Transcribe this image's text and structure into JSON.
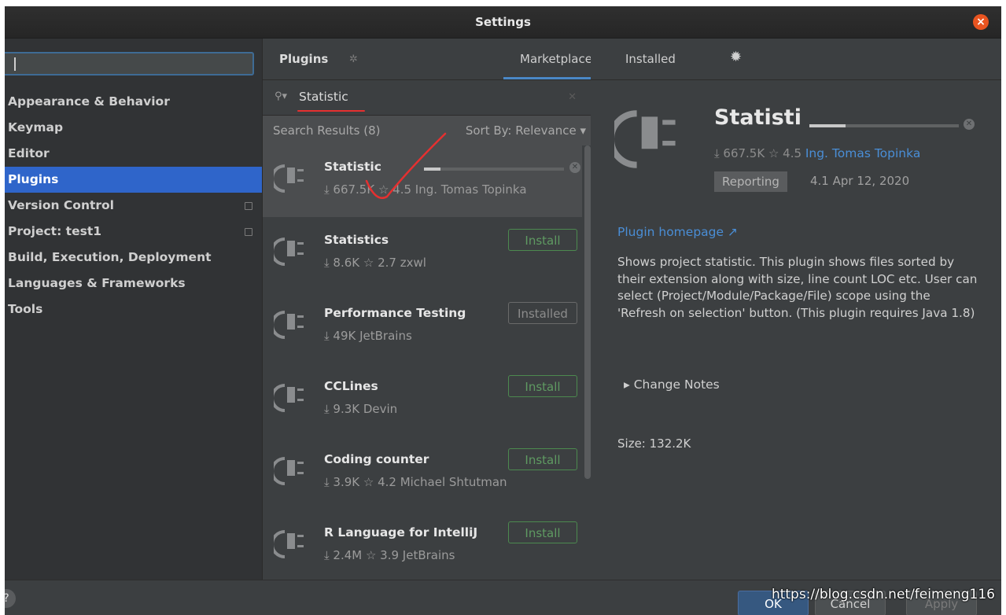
{
  "window": {
    "title": "Settings"
  },
  "left": {
    "search_value": "",
    "tree": [
      {
        "label": "Appearance & Behavior"
      },
      {
        "label": "Keymap"
      },
      {
        "label": "Editor"
      },
      {
        "label": "Plugins"
      },
      {
        "label": "Version Control"
      },
      {
        "label": "Project: test1"
      },
      {
        "label": "Build, Execution, Deployment"
      },
      {
        "label": "Languages & Frameworks"
      },
      {
        "label": "Tools"
      }
    ]
  },
  "header": {
    "plugins_label": "Plugins",
    "tabs": [
      {
        "label": "Marketplace",
        "active": true
      },
      {
        "label": "Installed",
        "active": false
      }
    ],
    "settings_icon": "gear-icon"
  },
  "search": {
    "query": "Statistic",
    "results_label": "Search Results (8)",
    "sort_label": "Sort By: Relevance"
  },
  "plugins": [
    {
      "name": "Statistic",
      "meta": "⤓ 667.5K ☆ 4.5 Ing. Tomas Topinka",
      "button": "",
      "status": "downloading",
      "progress": 0.12
    },
    {
      "name": "Statistics",
      "meta": "⤓ 8.6K ☆ 2.7 zxwl",
      "button": "Install"
    },
    {
      "name": "Performance Testing",
      "meta": "⤓ 49K JetBrains",
      "button": "Installed"
    },
    {
      "name": "CCLines",
      "meta": "⤓ 9.3K Devin",
      "button": "Install"
    },
    {
      "name": "Coding counter",
      "meta": "⤓ 3.9K ☆ 4.2 Michael Shtutman",
      "button": "Install"
    },
    {
      "name": "R Language for IntelliJ",
      "meta": "⤓ 2.4M ☆ 3.9 JetBrains",
      "button": "Install"
    }
  ],
  "detail": {
    "name": "Statisti",
    "downloads": "⤓ 667.5K",
    "rating": "☆ 4.5",
    "vendor": "Ing. Tomas Topinka",
    "tag": "Reporting",
    "version_date": "4.1 Apr 12, 2020",
    "homepage": "Plugin homepage ↗",
    "description": "Shows project statistic. This plugin shows files sorted by their extension along with size, line count LOC etc. User can select (Project/Module/Package/File) scope using the 'Refresh on selection' button. (This plugin requires Java 1.8)",
    "change_notes": "Change Notes",
    "size": "Size: 132.2K",
    "progress": 0.24
  },
  "footer": {
    "ok": "OK",
    "cancel": "Cancel",
    "apply": "Apply",
    "help": "?"
  },
  "watermark": "https://blog.csdn.net/feimeng116",
  "colors": {
    "accent": "#2f65ca",
    "link": "#4a8ed6",
    "install_green": "#5f9a62",
    "annotation_red": "#e53030",
    "close": "#e95420"
  }
}
